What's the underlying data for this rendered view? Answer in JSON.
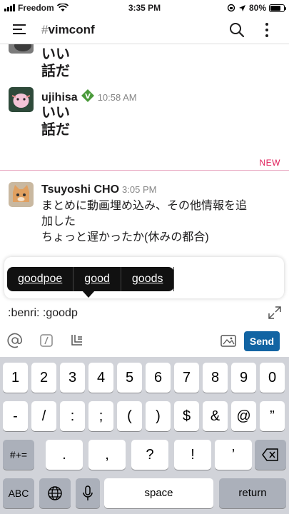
{
  "status_bar": {
    "carrier": "Freedom",
    "time": "3:35 PM",
    "battery": "80%",
    "battery_level": 0.8
  },
  "header": {
    "hash": "#",
    "channel": "vimconf"
  },
  "messages": [
    {
      "text_line1": "いい",
      "text_line2": "話だ"
    },
    {
      "author": "ujihisa",
      "time": "10:58 AM",
      "text_line1": "いい",
      "text_line2": "話だ"
    },
    {
      "author": "Tsuyoshi CHO",
      "time": "3:05 PM",
      "line1": "まとめに動画埋め込み、その他情報を追",
      "line2": "加した",
      "line3": "ちょっと遅かったか(休みの都合)"
    }
  ],
  "new_label": "NEW",
  "autocomplete": {
    "options": [
      "goodpoe",
      "good",
      "goods"
    ]
  },
  "composer": {
    "value": ":benri: :goodp",
    "send_label": "Send"
  },
  "colors": {
    "accent": "#1264a3",
    "new": "#e01e5a"
  },
  "keyboard": {
    "row1": [
      "1",
      "2",
      "3",
      "4",
      "5",
      "6",
      "7",
      "8",
      "9",
      "0"
    ],
    "row2": [
      "-",
      "/",
      ":",
      ";",
      "(",
      ")",
      "$",
      "&",
      "@",
      "”"
    ],
    "row3_left": "#+=",
    "row3": [
      ".",
      ",",
      "?",
      "!",
      "’"
    ],
    "row4": {
      "abc": "ABC",
      "space": "space",
      "return": "return"
    }
  }
}
